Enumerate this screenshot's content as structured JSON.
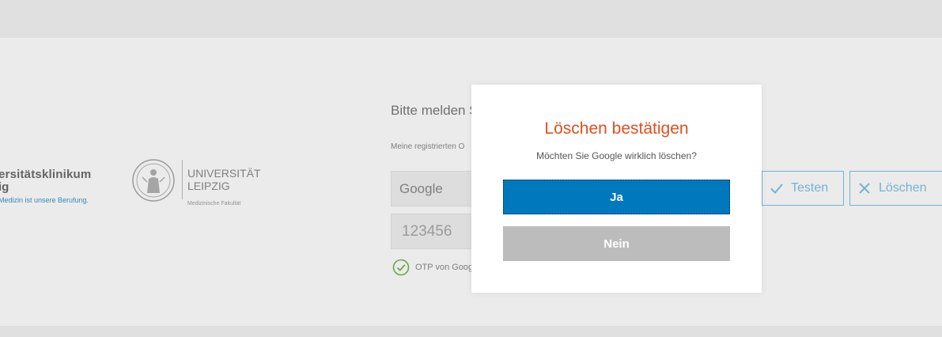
{
  "branding": {
    "ukl_name": "ersitätsklinikum",
    "ukl_city": "ig",
    "ukl_slogan": "Medizin ist unsere Berufung.",
    "uni_name": "UNIVERSITÄT",
    "uni_city": "LEIPZIG",
    "uni_faculty": "Medizinische Fakultät"
  },
  "form": {
    "title": "Bitte melden S",
    "subtitle": "Meine registrierten O",
    "provider_value": "Google",
    "code_placeholder": "123456",
    "otp_status": "OTP von Goog",
    "test_label": "Testen",
    "delete_label": "Löschen"
  },
  "dialog": {
    "title": "Löschen bestätigen",
    "message": "Möchten Sie Google wirklich löschen?",
    "yes_label": "Ja",
    "no_label": "Nein"
  },
  "colors": {
    "accent": "#0078bd",
    "title": "#e04f1d",
    "secondary_button": "#bcbcbc",
    "outline_button": "#7cc3e6",
    "success": "#77b255"
  }
}
